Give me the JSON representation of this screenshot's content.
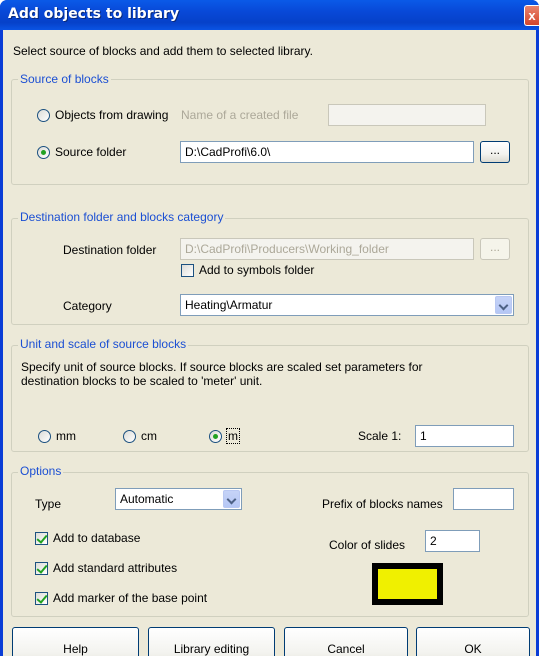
{
  "window": {
    "title": "Add objects to library",
    "close_symbol": "x"
  },
  "intro": "Select source of blocks and add them to selected library.",
  "source": {
    "legend": "Source of blocks",
    "objects_from_drawing_label": "Objects from drawing",
    "created_file_label": "Name of a created file",
    "created_file_value": "",
    "source_folder_label": "Source folder",
    "source_folder_value": "D:\\CadProfi\\6.0\\",
    "browse_label": "...",
    "selected": "source_folder"
  },
  "destination": {
    "legend": "Destination folder and blocks category",
    "folder_label": "Destination folder",
    "folder_value": "D:\\CadProfi\\Producers\\Working_folder",
    "browse_label": "...",
    "add_symbols_label": "Add to symbols folder",
    "add_symbols_checked": false,
    "category_label": "Category",
    "category_value": "Heating\\Armatur"
  },
  "unit": {
    "legend": "Unit and scale of source blocks",
    "description_line1": "Specify unit of source blocks. If source blocks are scaled set parameters for",
    "description_line2": "destination blocks to be scaled to 'meter' unit.",
    "mm_label": "mm",
    "cm_label": "cm",
    "m_label": "m",
    "selected": "m",
    "scale_label": "Scale 1:",
    "scale_value": "1"
  },
  "options": {
    "legend": "Options",
    "type_label": "Type",
    "type_value": "Automatic",
    "prefix_label": "Prefix of blocks names",
    "prefix_value": "",
    "add_database_label": "Add to database",
    "add_database_checked": true,
    "add_attributes_label": "Add standard attributes",
    "add_attributes_checked": true,
    "add_marker_label": "Add marker of the base point",
    "add_marker_checked": true,
    "color_label": "Color of slides",
    "color_value": "2",
    "color_swatch": "#f0f000"
  },
  "buttons": {
    "help": "Help",
    "library_editing": "Library editing",
    "cancel": "Cancel",
    "ok": "OK"
  }
}
